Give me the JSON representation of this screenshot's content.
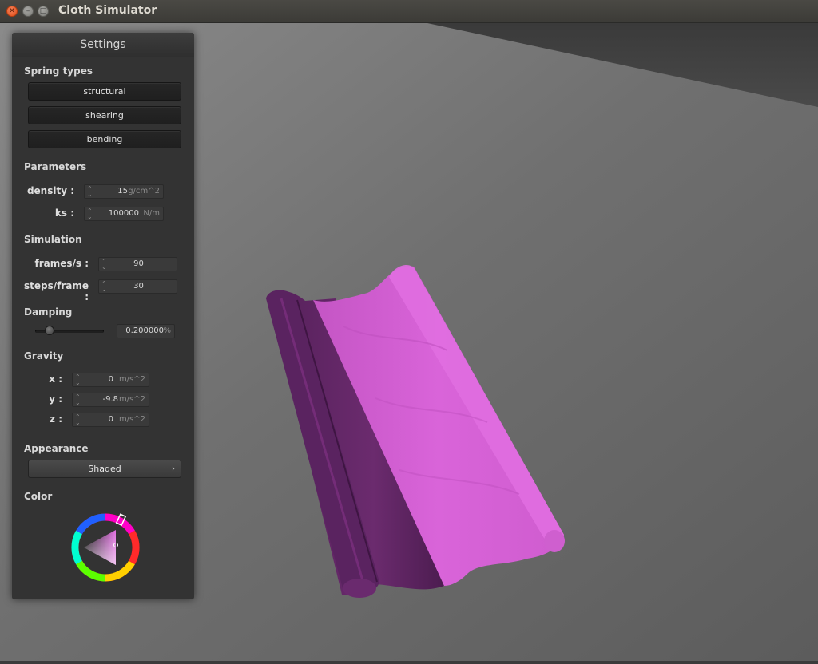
{
  "window": {
    "title": "Cloth Simulator"
  },
  "icons": {
    "close": "close-icon",
    "minimize": "minimize-icon",
    "maximize": "maximize-icon"
  },
  "panel": {
    "title": "Settings",
    "spring_types": {
      "heading": "Spring types",
      "buttons": [
        "structural",
        "shearing",
        "bending"
      ]
    },
    "parameters": {
      "heading": "Parameters",
      "density": {
        "label": "density :",
        "value": "15",
        "unit": "g/cm^2"
      },
      "ks": {
        "label": "ks :",
        "value": "100000",
        "unit": "N/m"
      }
    },
    "simulation": {
      "heading": "Simulation",
      "fps": {
        "label": "frames/s :",
        "value": "90"
      },
      "steps": {
        "label": "steps/frame :",
        "value": "30"
      }
    },
    "damping": {
      "heading": "Damping",
      "value": "0.200000",
      "unit": "%",
      "slider_level": 0.2
    },
    "gravity": {
      "heading": "Gravity",
      "x": {
        "label": "x :",
        "value": "0",
        "unit": "m/s^2"
      },
      "y": {
        "label": "y :",
        "value": "-9.8",
        "unit": "m/s^2"
      },
      "z": {
        "label": "z :",
        "value": "0",
        "unit": "m/s^2"
      }
    },
    "appearance": {
      "heading": "Appearance",
      "selected": "Shaded",
      "chevron": "›"
    },
    "color": {
      "heading": "Color",
      "current": "#d65fd6"
    }
  },
  "scene": {
    "background": "#6a6a6a",
    "cloth_light": "#d865d8",
    "cloth_dark": "#5e2560"
  }
}
